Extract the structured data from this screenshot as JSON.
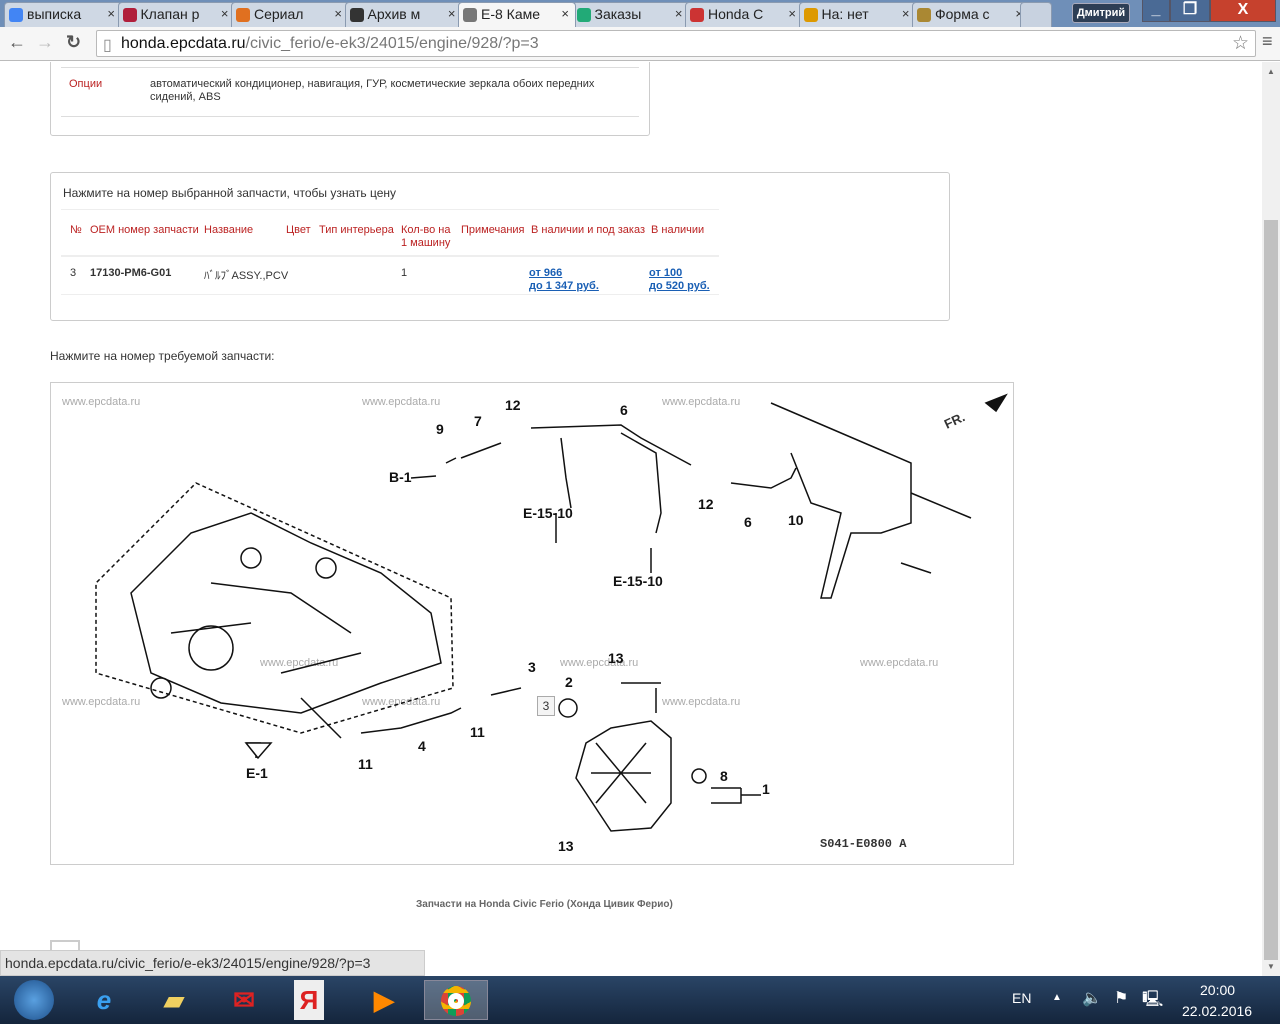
{
  "browser": {
    "tabs": [
      {
        "label": "выписка",
        "icon": "google-icon",
        "color": "#4285f4"
      },
      {
        "label": "Клапан р",
        "icon": "d-icon",
        "color": "#b01e3a"
      },
      {
        "label": "Сериал",
        "icon": "fox-icon",
        "color": "#e07020"
      },
      {
        "label": "Архив м",
        "icon": "clapper-icon",
        "color": "#333"
      },
      {
        "label": "E-8 Каме",
        "icon": "gear-icon",
        "color": "#777"
      },
      {
        "label": "Заказы",
        "icon": "e-icon",
        "color": "#2a7"
      },
      {
        "label": "Honda С",
        "icon": "e-icon",
        "color": "#c33"
      },
      {
        "label": "На: нет",
        "icon": "mail-icon",
        "color": "#d90"
      },
      {
        "label": "Форма с",
        "icon": "emblem-icon",
        "color": "#a83"
      }
    ],
    "active_tab": 4,
    "user": "Дмитрий",
    "url_host": "honda.epcdata.ru",
    "url_path": "/civic_ferio/e-ek3/24015/engine/928/?p=3",
    "status_url": "honda.epcdata.ru/civic_ferio/e-ek3/24015/engine/928/?p=3"
  },
  "spec": {
    "options_label": "Опции",
    "options_value": "автоматический кондиционер, навигация, ГУР, косметические зеркала обоих передних сидений, ABS"
  },
  "parts": {
    "hint": "Нажмите на номер выбранной запчасти, чтобы узнать цену",
    "headers": [
      "№",
      "OEM номер запчасти",
      "Название",
      "Цвет",
      "Тип интерьера",
      "Кол-во на 1 машину",
      "Примечания",
      "В наличии и под заказ",
      "В наличии"
    ],
    "rows": [
      {
        "no": "3",
        "oem": "17130-PM6-G01",
        "name": "ﾊﾞﾙﾌﾞASSY.,PCV",
        "qty": "1",
        "order_from": "от 966",
        "order_to": "до 1 347 руб.",
        "stock_from": "от 100",
        "stock_to": "до 520 руб."
      }
    ]
  },
  "diagram": {
    "prompt": "Нажмите на номер требуемой запчасти:",
    "watermark": "www.epcdata.ru",
    "code": "S041-E0800 A",
    "fr": "FR.",
    "callouts": [
      "9",
      "7",
      "12",
      "6",
      "B-1",
      "E-15-10",
      "E-15-10",
      "12",
      "6",
      "10",
      "E-1",
      "11",
      "4",
      "11",
      "3",
      "2",
      "13",
      "8",
      "1",
      "13"
    ],
    "tooltip": "3",
    "caption": "Запчасти на Honda Civic Ferio (Хонда Цивик Ферио)"
  },
  "taskbar": {
    "lang": "EN",
    "time": "20:00",
    "date": "22.02.2016"
  }
}
